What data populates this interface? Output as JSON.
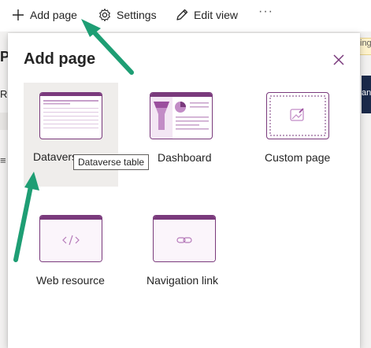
{
  "commandbar": {
    "add_page_label": "Add page",
    "settings_label": "Settings",
    "edit_view_label": "Edit view",
    "more_label": "···"
  },
  "background": {
    "title_fragment": "P",
    "row_fragment": "Re",
    "list_icon": "≡",
    "banner_fragment": "ing v",
    "button_fragment": "an"
  },
  "panel": {
    "title": "Add page",
    "tiles": [
      {
        "label": "Datavers",
        "icon": "table-thumbnail"
      },
      {
        "label": "Dashboard",
        "icon": "dashboard-thumbnail"
      },
      {
        "label": "Custom page",
        "icon": "custom-page-thumbnail"
      },
      {
        "label": "Web resource",
        "icon": "code-thumbnail"
      },
      {
        "label": "Navigation link",
        "icon": "link-thumbnail"
      }
    ],
    "tooltip": "Dataverse table"
  },
  "colors": {
    "accent_purple": "#7a3a7c",
    "light_purple": "#e6cde8",
    "annotation_green": "#1e9e74",
    "selected_tile_bg": "#efedeb"
  }
}
